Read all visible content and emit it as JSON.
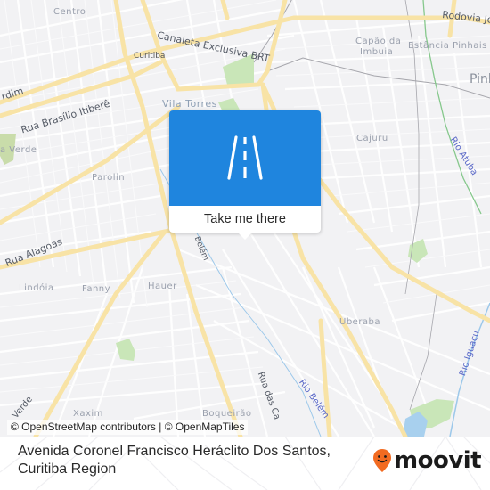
{
  "map": {
    "background_color": "#f2f2f4",
    "labels": {
      "centro": "Centro",
      "canaleta": "Canaleta Exclusiva BRT",
      "curitiba": "Curitiba",
      "rodovia": "Rodovia João",
      "capao_line1": "Capão da",
      "capao_line2": "Imbuia",
      "estancia": "Estância Pinhais",
      "pinhais": "Pinh",
      "jardim": "rdim",
      "vila_torres": "Vila Torres",
      "brasilio": "Rua Brasílio Itiberê",
      "verde": "a Verde",
      "cajuru": "Cajuru",
      "rio_atuba": "Rio Atuba",
      "parolin": "Parolin",
      "alagoas": "Rua Alagoas",
      "belem_top": "Belém",
      "lindoia": "Lindóia",
      "fanny": "Fanny",
      "hauer": "Hauer",
      "uberaba": "Uberaba",
      "rio_iguacu": "Rio Iguaçu",
      "rua_das": "Rua das Ca",
      "rio_belem": "Rio Belém",
      "verde_bottom": "Verde",
      "xaxim": "Xaxim",
      "boqueirao": "Boqueirão"
    },
    "attribution": "© OpenStreetMap contributors | © OpenMapTiles"
  },
  "popup": {
    "icon": "road-icon",
    "button_label": "Take me there",
    "color": "#1f85de"
  },
  "footer": {
    "title": "Avenida Coronel Francisco Heráclito Dos Santos, Curitiba Region",
    "brand": "moovit",
    "brand_color": "#f26b21"
  }
}
